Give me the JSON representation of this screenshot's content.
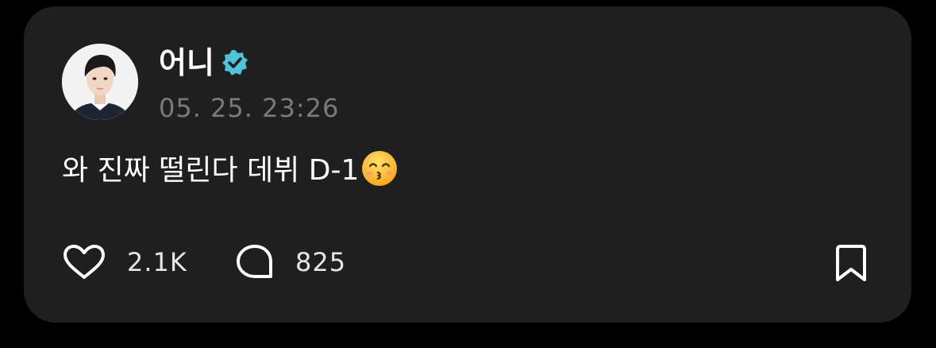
{
  "post": {
    "author": {
      "name": "어니",
      "verified": true,
      "badge_color": "#4fc3d9",
      "avatar_icon": "profile-photo"
    },
    "timestamp": "05. 25. 23:26",
    "text": "와 진짜 떨린다 데뷔 D-1",
    "emoji": "kissing-face-with-smiling-eyes"
  },
  "actions": {
    "likes": {
      "icon": "heart-icon",
      "count": "2.1K"
    },
    "comments": {
      "icon": "comment-bubble-icon",
      "count": "825"
    },
    "bookmark": {
      "icon": "bookmark-icon"
    }
  },
  "colors": {
    "background": "#000000",
    "card": "#1f1f1f",
    "text": "#ffffff",
    "timestamp": "#7a7a7a"
  }
}
